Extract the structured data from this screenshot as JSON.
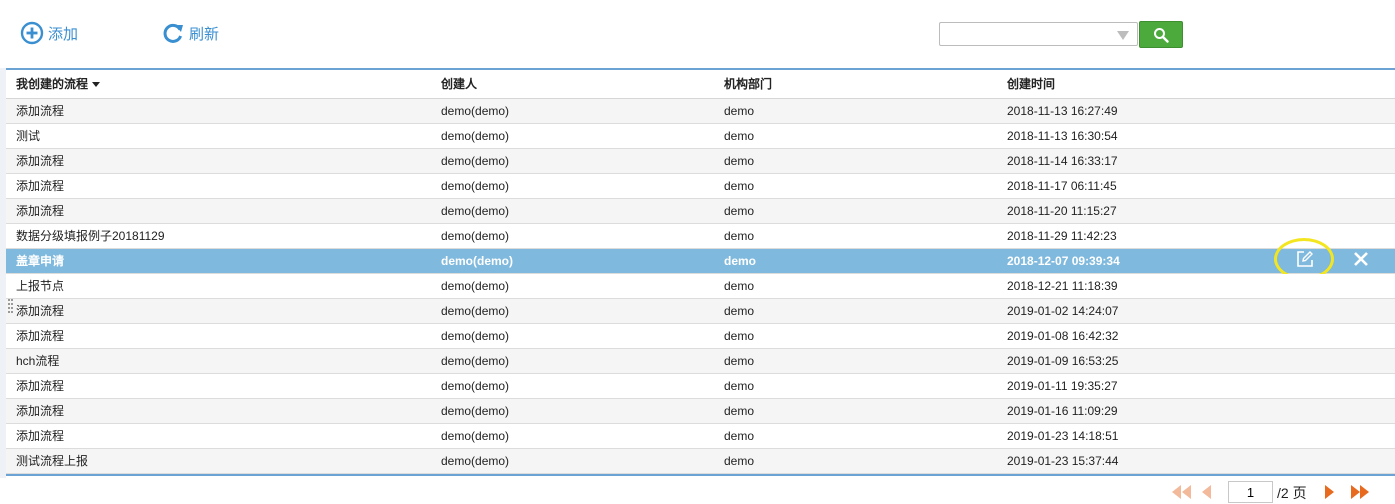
{
  "toolbar": {
    "add_label": "添加",
    "refresh_label": "刷新",
    "search_value": "",
    "accent_color": "#3a8fd0",
    "search_button_color": "#4caa3c"
  },
  "table": {
    "headers": [
      "我创建的流程",
      "创建人",
      "机构部门",
      "创建时间"
    ],
    "selected_row": 6,
    "rows": [
      [
        "添加流程",
        "demo(demo)",
        "demo",
        "2018-11-13 16:27:49"
      ],
      [
        "测试",
        "demo(demo)",
        "demo",
        "2018-11-13 16:30:54"
      ],
      [
        "添加流程",
        "demo(demo)",
        "demo",
        "2018-11-14 16:33:17"
      ],
      [
        "添加流程",
        "demo(demo)",
        "demo",
        "2018-11-17 06:11:45"
      ],
      [
        "添加流程",
        "demo(demo)",
        "demo",
        "2018-11-20 11:15:27"
      ],
      [
        "数据分级填报例子20181129",
        "demo(demo)",
        "demo",
        "2018-11-29 11:42:23"
      ],
      [
        "盖章申请",
        "demo(demo)",
        "demo",
        "2018-12-07 09:39:34"
      ],
      [
        "上报节点",
        "demo(demo)",
        "demo",
        "2018-12-21 11:18:39"
      ],
      [
        "添加流程",
        "demo(demo)",
        "demo",
        "2019-01-02 14:24:07"
      ],
      [
        "添加流程",
        "demo(demo)",
        "demo",
        "2019-01-08 16:42:32"
      ],
      [
        "hch流程",
        "demo(demo)",
        "demo",
        "2019-01-09 16:53:25"
      ],
      [
        "添加流程",
        "demo(demo)",
        "demo",
        "2019-01-11 19:35:27"
      ],
      [
        "添加流程",
        "demo(demo)",
        "demo",
        "2019-01-16 11:09:29"
      ],
      [
        "添加流程",
        "demo(demo)",
        "demo",
        "2019-01-23 14:18:51"
      ],
      [
        "测试流程上报",
        "demo(demo)",
        "demo",
        "2019-01-23 15:37:44"
      ]
    ],
    "selected_row_color": "#7fb9dd",
    "highlight_color": "#f3e620"
  },
  "pager": {
    "current_page": "1",
    "total_label": "/2 页",
    "arrow_color": "#e86a1e"
  }
}
